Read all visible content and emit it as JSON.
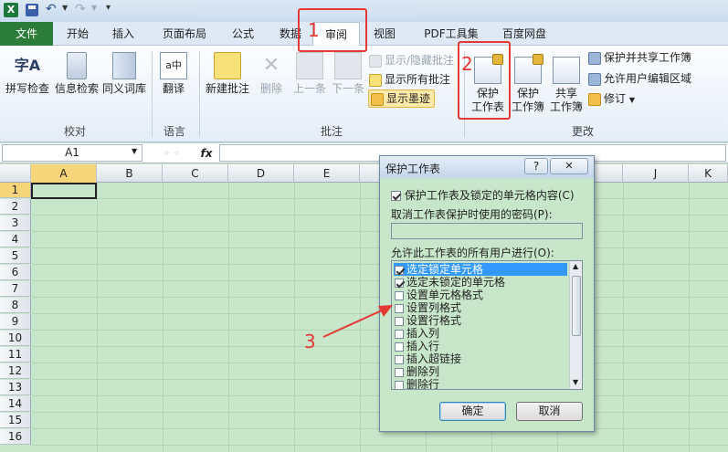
{
  "qat": {
    "doc_title": "",
    "app_icon": "excel-icon"
  },
  "tabs": [
    {
      "label": "文件"
    },
    {
      "label": "开始"
    },
    {
      "label": "插入"
    },
    {
      "label": "页面布局"
    },
    {
      "label": "公式"
    },
    {
      "label": "数据"
    },
    {
      "label": "审阅"
    },
    {
      "label": "视图"
    },
    {
      "label": "PDF工具集"
    },
    {
      "label": "百度网盘"
    }
  ],
  "ribbon": {
    "proofing": {
      "spell": "拼写检查",
      "research": "信息检索",
      "thesaurus": "同义词库",
      "group": "校对"
    },
    "language": {
      "translate": "翻译",
      "group": "语言"
    },
    "comments": {
      "new": "新建批注",
      "delete": "删除",
      "prev": "上一条",
      "next": "下一条",
      "show_hide": "显示/隐藏批注",
      "show_all": "显示所有批注",
      "show_ink": "显示墨迹",
      "group": "批注"
    },
    "changes": {
      "protect_sheet_1": "保护",
      "protect_sheet_2": "工作表",
      "protect_wb_1": "保护",
      "protect_wb_2": "工作簿",
      "share_wb_1": "共享",
      "share_wb_2": "工作簿",
      "protect_share": "保护并共享工作簿",
      "allow_edit": "允许用户编辑区域",
      "track": "修订",
      "group": "更改"
    }
  },
  "formula_bar": {
    "name_box": "A1",
    "fx": "fx",
    "content": ""
  },
  "columns": [
    "A",
    "B",
    "C",
    "D",
    "E",
    "F",
    "G",
    "H",
    "I",
    "J",
    "K"
  ],
  "rows": [
    "1",
    "2",
    "3",
    "4",
    "5",
    "6",
    "7",
    "8",
    "9",
    "10",
    "11",
    "12",
    "13",
    "14",
    "15",
    "16"
  ],
  "dialog": {
    "title": "保护工作表",
    "help": "?",
    "close": "✕",
    "protect_label": "保护工作表及锁定的单元格内容(C)",
    "protect_checked": true,
    "password_label": "取消工作表保护时使用的密码(P):",
    "password_value": "",
    "allow_label": "允许此工作表的所有用户进行(O):",
    "permissions": [
      {
        "label": "选定锁定单元格",
        "checked": true
      },
      {
        "label": "选定未锁定的单元格",
        "checked": true
      },
      {
        "label": "设置单元格格式",
        "checked": false
      },
      {
        "label": "设置列格式",
        "checked": false
      },
      {
        "label": "设置行格式",
        "checked": false
      },
      {
        "label": "插入列",
        "checked": false
      },
      {
        "label": "插入行",
        "checked": false
      },
      {
        "label": "插入超链接",
        "checked": false
      },
      {
        "label": "删除列",
        "checked": false
      },
      {
        "label": "删除行",
        "checked": false
      }
    ],
    "ok": "确定",
    "cancel": "取消"
  },
  "annotations": {
    "n1": "1",
    "n2": "2",
    "n3": "3"
  },
  "colors": {
    "accent_red": "#e53935",
    "file_tab": "#2d7d3a",
    "sheet_bg": "#c8e6c9"
  }
}
